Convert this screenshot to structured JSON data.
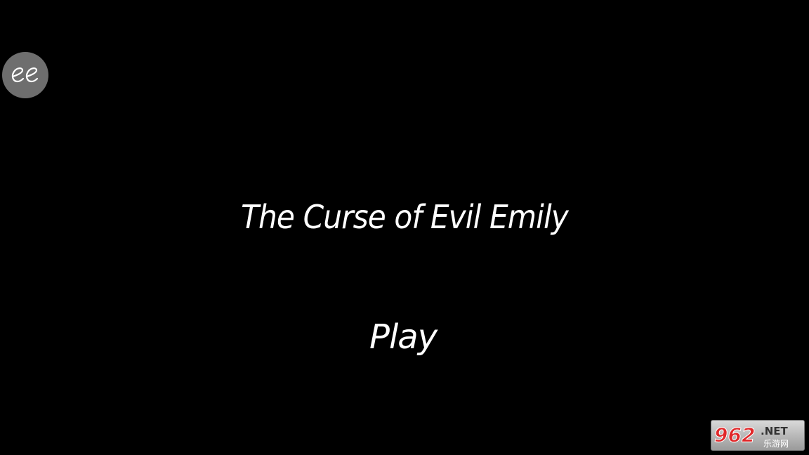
{
  "game": {
    "title": "The Curse of Evil Emily",
    "play_label": "Play"
  },
  "logo": {
    "icon": "ee-logo-icon",
    "text": "ee",
    "background": "#6e6e6e"
  },
  "watermark": {
    "number": "962",
    "net": ".NET",
    "cn": "乐游网"
  },
  "colors": {
    "background": "#000000",
    "text": "#ffffff",
    "watermark_accent": "#e0282a"
  }
}
